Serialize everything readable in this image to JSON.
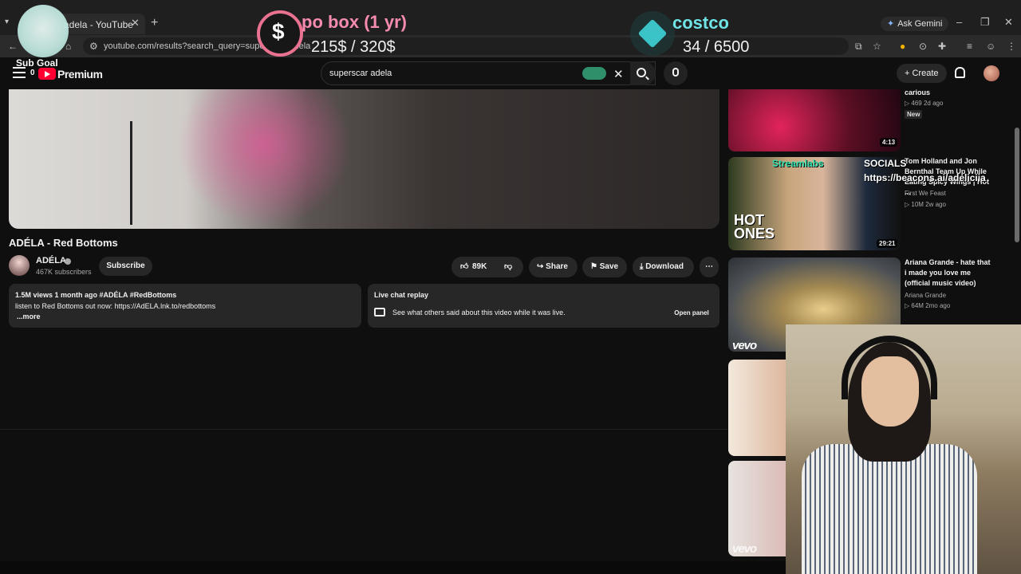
{
  "browser": {
    "tab_title": "adela - YouTube",
    "url": "youtube.com/results?search_query=superscar+adela",
    "ask_gemini": "Ask Gemini"
  },
  "masthead": {
    "brand": "Premium",
    "search_value": "superscar adela",
    "create_label": "Create"
  },
  "video": {
    "title": "ADÉLA - Red Bottoms",
    "channel": "ADÉLA",
    "subscribers": "467K subscribers",
    "subscribe_label": "Subscribe",
    "likes": "89K",
    "share_label": "Share",
    "save_label": "Save",
    "download_label": "Download",
    "desc_stats": "1.5M views  1 month ago  #ADÉLA #RedBottoms",
    "desc_line": "listen to Red Bottoms out now: https://AdELA.lnk.to/redbottoms",
    "desc_more": "...more",
    "chat_title": "Live chat replay",
    "chat_text": "See what others said about this video while it was live.",
    "chat_open": "Open panel"
  },
  "sidebar": {
    "items": [
      {
        "title": "carious",
        "meta": "▷ 469  2d ago",
        "badge": "New",
        "duration": "4:13"
      },
      {
        "title": "Tom Holland and Jon Bernthal Team Up While Eating Spicy Wings | Hot ...",
        "channel": "First We Feast",
        "meta": "▷ 10M  2w ago",
        "duration": "29:21",
        "thumb_text": "HOT ONES"
      },
      {
        "title": "Ariana Grande - hate that i made you love me (official music video)",
        "channel": "Ariana Grande",
        "meta": "▷ 64M  2mo ago",
        "thumb_text": "vevo"
      },
      {
        "thumb_text": "vevo"
      }
    ]
  },
  "overlay": {
    "sub_goal": "Sub Goal",
    "sub_count": "0",
    "goal1_icon": "$",
    "goal1_title": "po box (1 yr)",
    "goal1_value": "215$ / 320$",
    "goal2_title": "costco",
    "goal2_value": "34 / 6500",
    "streamlabs": "Streamlabs",
    "socials": "SOCIALS",
    "beacons": "https://beacons.ai/adeliciia"
  },
  "colors": {
    "background": "#0f0f0f",
    "yt_red": "#ff0033",
    "goal1_accent": "#f58bb0",
    "goal2_accent": "#6fe3e6"
  }
}
